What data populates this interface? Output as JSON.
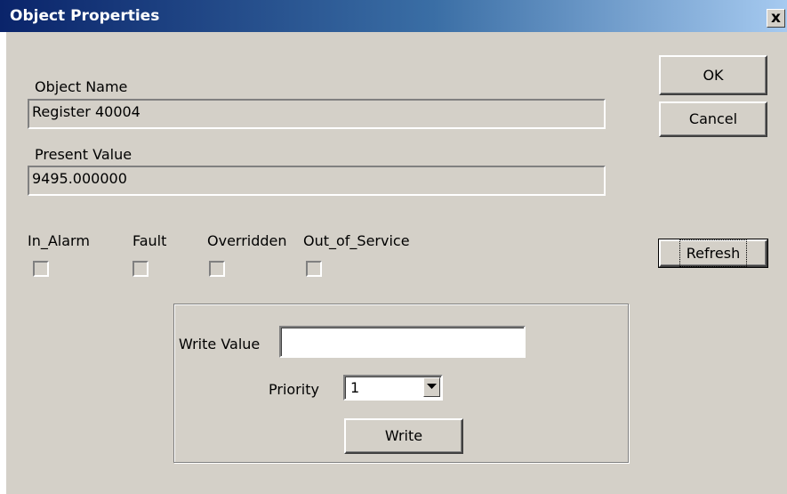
{
  "window": {
    "title": "Object Properties",
    "close_glyph": "x"
  },
  "object_name": {
    "label": "Object Name",
    "value": "Register 40004"
  },
  "present_value": {
    "label": "Present Value",
    "value": "9495.000000"
  },
  "flags": [
    {
      "label": "In_Alarm",
      "checked": false
    },
    {
      "label": "Fault",
      "checked": false
    },
    {
      "label": "Overridden",
      "checked": false
    },
    {
      "label": "Out_of_Service",
      "checked": false
    }
  ],
  "buttons": {
    "ok": "OK",
    "cancel": "Cancel",
    "refresh": "Refresh"
  },
  "write_group": {
    "write_value_label": "Write Value",
    "write_value": "",
    "priority_label": "Priority",
    "priority_selected": "1",
    "write_button": "Write"
  },
  "colors": {
    "dialog_bg": "#d4d0c8",
    "titlebar_start": "#0a246a",
    "titlebar_end": "#a6caf0"
  }
}
